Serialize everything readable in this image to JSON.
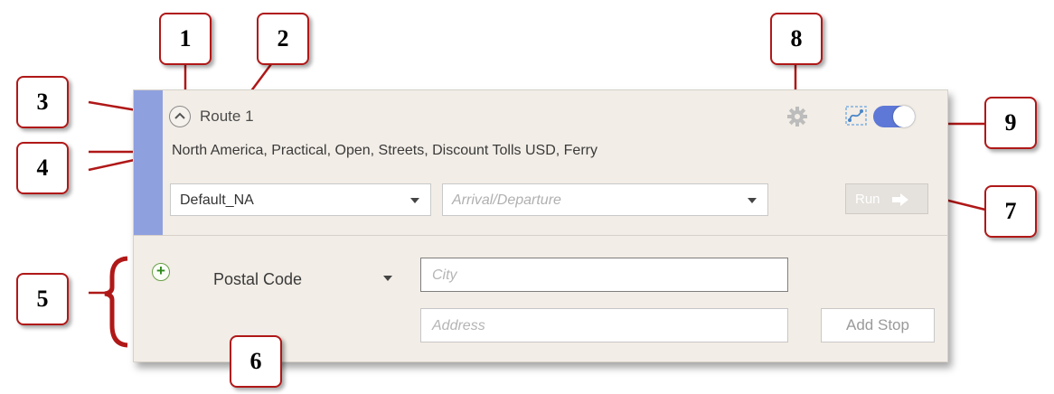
{
  "route": {
    "title": "Route 1",
    "summary": "North America, Practical, Open, Streets, Discount Tolls USD, Ferry",
    "profile_value": "Default_NA",
    "timing_placeholder": "Arrival/Departure",
    "run_label": "Run",
    "toggle_on": true,
    "accent_color": "#8fa0df"
  },
  "stop": {
    "type_value": "Postal Code",
    "city_placeholder": "City",
    "address_placeholder": "Address",
    "add_stop_label": "Add Stop"
  },
  "callouts": [
    "1",
    "2",
    "3",
    "4",
    "5",
    "6",
    "7",
    "8",
    "9"
  ],
  "icons": [
    "chevron-up-icon",
    "gear-icon",
    "route-map-icon",
    "plus-icon",
    "arrow-right-icon"
  ]
}
